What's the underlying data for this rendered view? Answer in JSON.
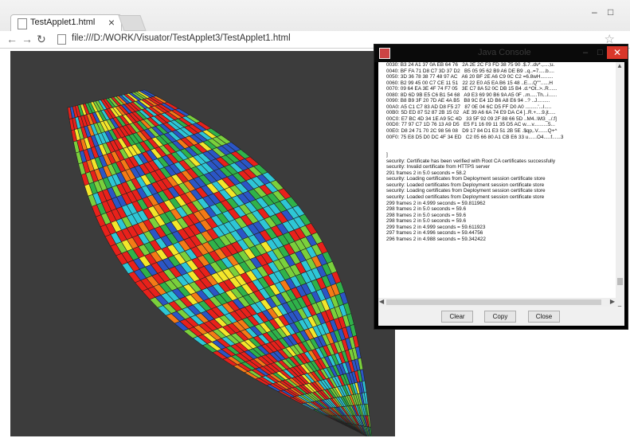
{
  "browser": {
    "tab_title": "TestApplet1.html",
    "tab_close": "×",
    "url": "file:///D:/WORK/Visuator/TestApplet3/TestApplet1.html",
    "window_minimize": "–",
    "window_maximize": "□"
  },
  "console": {
    "title": "Java Console",
    "close_glyph": "✕",
    "lines": [
      "0030: B3 24 A1 37 0A EB 64 76   2A 2E 2C F3 FD 38 75 90 .$.7..dv*.,....;u.",
      "0040: BF FA 71 D8 C7 3D 37 D2   B5 05 95 62 B9 A6 DE B9 ..q..=7.....b....",
      "0050: 3D 36 78 38 77 48 97 AC   A6 20 BF 2E A6 C9 0C C2 =6.8wH.........",
      "0060: B2 99 45 00 C7 CE 11 51   22 22 E0 A5 EA B6 15 48 ..E....Q\"\"......H",
      "0070: 09 64 EA 3E 4F 74 F7 05   3E C7 8A 52 0C DB 15 B4 .d.^Ot..>..R......",
      "0080: 8D 6D 9B E5 C6 B1 54 68   A9 E3 69 90 B6 9A A5 0F ..m.....Th...i......",
      "0090: B8 B9 3F 20 7D AE 4A B5   B8 9C E4 1D B6 A8 E6 94 ..? ..J.........",
      "00A0: A5 C1 C7 83 AD D8 F5 27   87 0E 04 6C D5 FF D0 A0 .........'...l.....",
      "00B0: 5D ED 87 52 87 2B 15 02   AE 39 A6 6A 74 E9 DA C4 ]..R.+....9.jt.....",
      "00C0: E7 BC 4D 34 1E A9 5C 4D   33 5F 92 09 2F 88 66 5D ..M4..\\M3_../.f]",
      "00D0: 77 97 C7 1D 76 13 A9 D5   E5 F1 16 09 11 35 D5 AC w....v..........5...",
      "00E0: D8 24 71 70 2C 98 56 08   D9 17 84 D1 E3 51 2B 5E .$qp,.V.......Q+^",
      "00F0: 75 E8 D5 D0 DC 4F 34 ED   C2 05 66 80 A1 CB E6 33 u......O4.....f......3",
      "",
      "",
      "]",
      "security: Certificate has been verified with Root CA certificates successfully",
      "security: Invalid certificate from HTTPS server",
      "291 frames 2 in 5.0 seconds = 58.2",
      "security: Loading certificates from Deployment session certificate store",
      "security: Loaded certificates from Deployment session certificate store",
      "security: Loading certificates from Deployment session certificate store",
      "security: Loaded certificates from Deployment session certificate store",
      "299 frames 2 in 4.999 seconds = 59.811962",
      "298 frames 2 in 5.0 seconds = 59.6",
      "298 frames 2 in 5.0 seconds = 59.6",
      "298 frames 2 in 5.0 seconds = 59.6",
      "299 frames 2 in 4.999 seconds = 59.611923",
      "297 frames 2 in 4.996 seconds = 59.44756",
      "296 frames 2 in 4.988 seconds = 59.342422"
    ],
    "buttons": {
      "clear": "Clear",
      "copy": "Copy",
      "close": "Close"
    }
  },
  "applet": {
    "palette": [
      "#e8211b",
      "#e8211b",
      "#e8211b",
      "#e8211b",
      "#f47a16",
      "#f3e62a",
      "#7ad03c",
      "#2fb24a",
      "#2ec6d6",
      "#2b56c6"
    ]
  }
}
